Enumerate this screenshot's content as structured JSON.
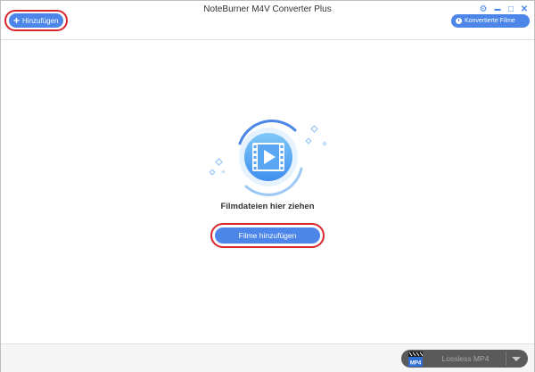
{
  "window": {
    "title": "NoteBurner M4V Converter Plus"
  },
  "toolbar": {
    "add_label": "Hinzufügen",
    "add_icon": "plus-icon",
    "converted_label": "Konvertierte Filme",
    "converted_icon": "clock-icon",
    "controls": {
      "settings": "⚙",
      "minimize": "▬",
      "maximize": "□",
      "close": "✕"
    }
  },
  "main": {
    "drop_icon": "film-play-icon",
    "drop_text": "Filmdateien hier ziehen",
    "add_films_label": "Filme hinzufügen"
  },
  "footer": {
    "format_icon_text": "MP4",
    "format_label": "Lossless MP4"
  },
  "colors": {
    "accent": "#4b86e8",
    "highlight_ring": "#d8262c",
    "icon_gradient_top": "#7fc8f8",
    "icon_gradient_bottom": "#3f8ef0"
  }
}
